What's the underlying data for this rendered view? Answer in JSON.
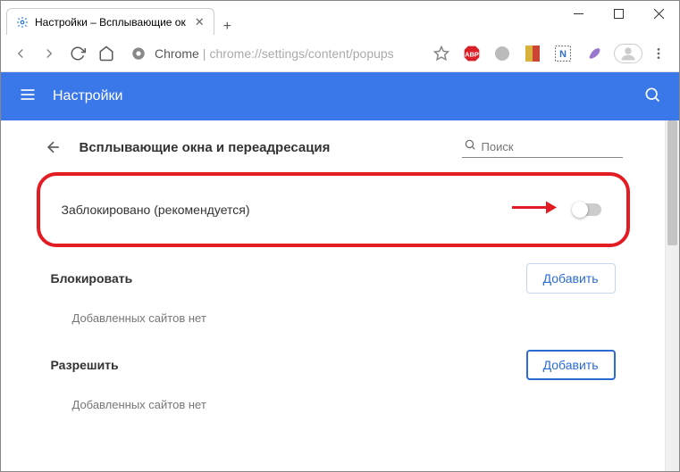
{
  "window": {
    "tab_title": "Настройки – Всплывающие ок"
  },
  "addressbar": {
    "origin": "Chrome",
    "path": "chrome://settings/content/popups"
  },
  "blue_header": {
    "title": "Настройки"
  },
  "breadcrumb": {
    "title": "Всплывающие окна и переадресация",
    "search_placeholder": "Поиск"
  },
  "main_toggle": {
    "label": "Заблокировано (рекомендуется)",
    "checked": false
  },
  "sections": {
    "block": {
      "title": "Блокировать",
      "add_label": "Добавить",
      "empty_text": "Добавленных сайтов нет"
    },
    "allow": {
      "title": "Разрешить",
      "add_label": "Добавить",
      "empty_text": "Добавленных сайтов нет"
    }
  }
}
